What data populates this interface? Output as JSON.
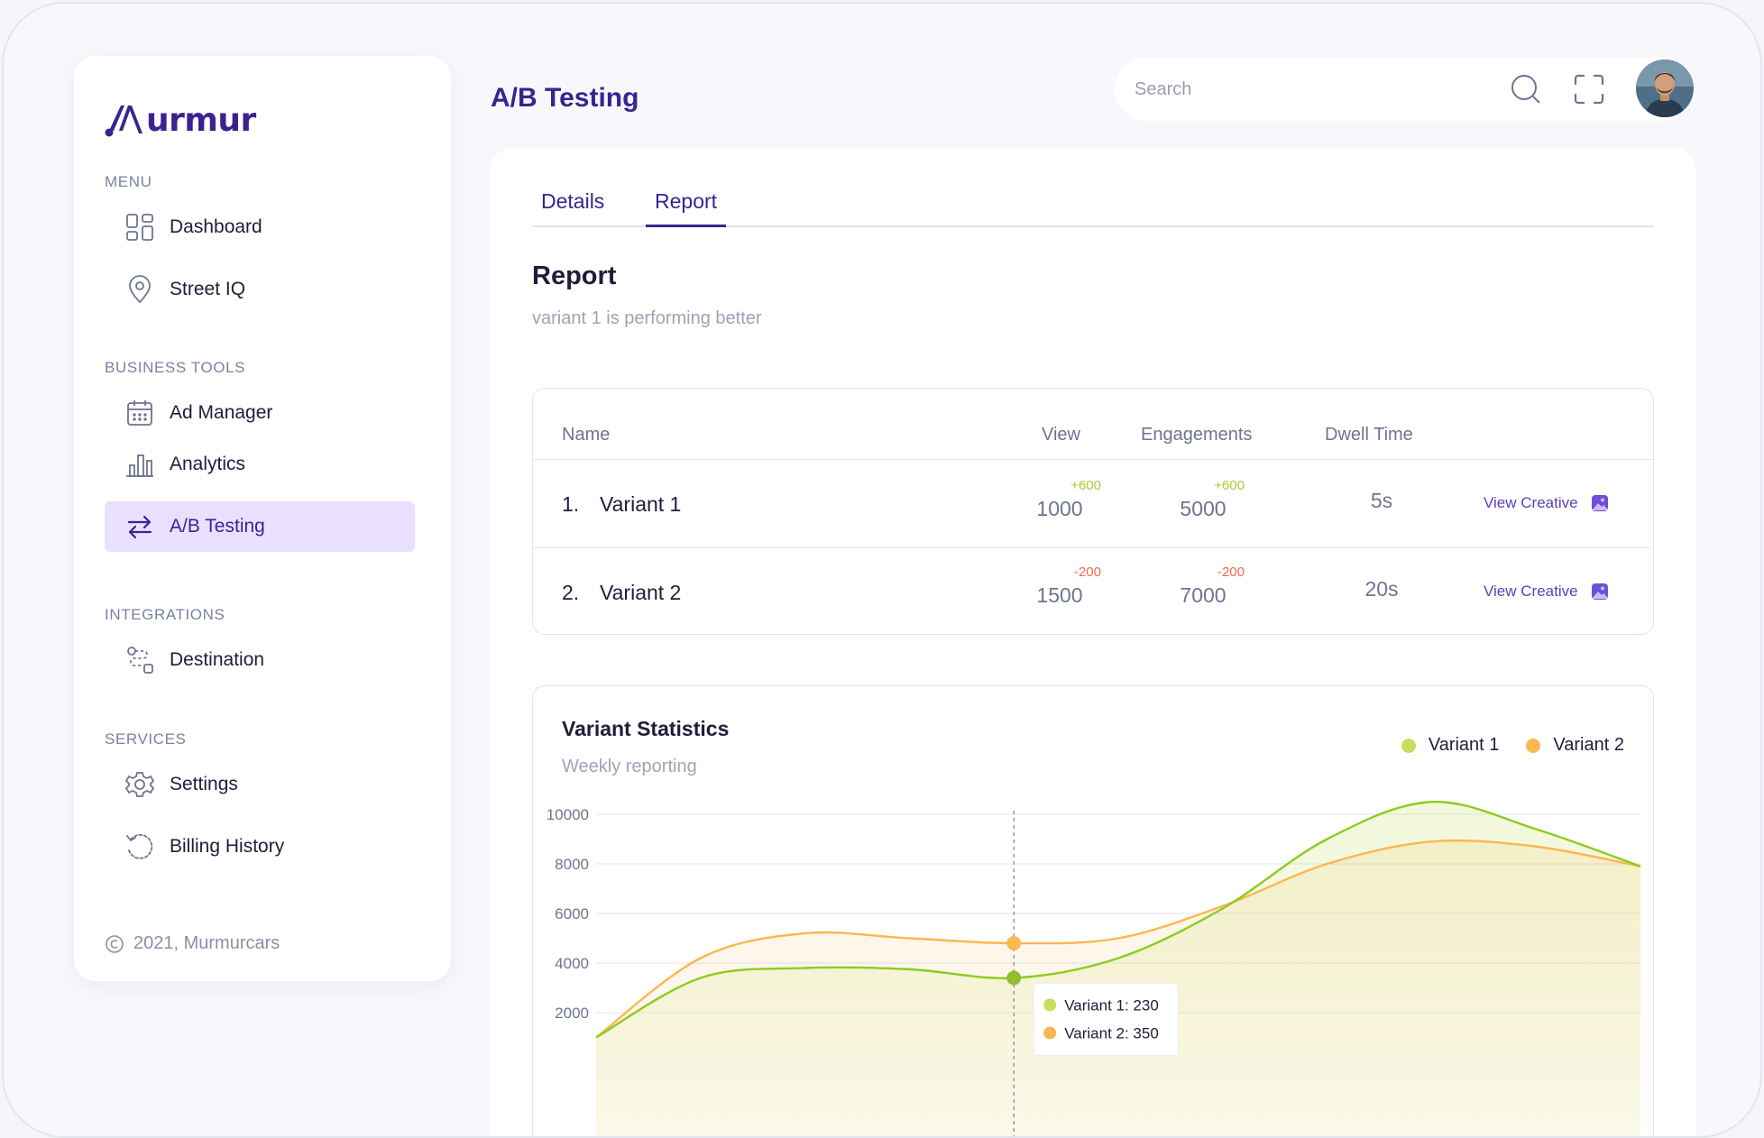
{
  "app": {
    "logo_text": "urmur",
    "brand_color": "#3a2391"
  },
  "sidebar": {
    "sections": [
      {
        "label": "MENU"
      },
      {
        "label": "BUSINESS TOOLS"
      },
      {
        "label": "INTEGRATIONS"
      },
      {
        "label": "SERVICES"
      }
    ],
    "items": [
      {
        "label": "Dashboard",
        "icon": "grid-icon"
      },
      {
        "label": "Street IQ",
        "icon": "location-pin-icon"
      },
      {
        "label": "Ad Manager",
        "icon": "calendar-icon"
      },
      {
        "label": "Analytics",
        "icon": "bar-chart-icon"
      },
      {
        "label": "A/B Testing",
        "icon": "swap-arrows-icon",
        "active": true
      },
      {
        "label": "Destination",
        "icon": "route-icon"
      },
      {
        "label": "Settings",
        "icon": "gear-icon"
      },
      {
        "label": "Billing History",
        "icon": "history-icon"
      }
    ],
    "copyright": "2021, Murmurcars"
  },
  "header": {
    "title": "A/B Testing",
    "search_placeholder": "Search"
  },
  "tabs": [
    {
      "label": "Details",
      "active": false
    },
    {
      "label": "Report",
      "active": true
    }
  ],
  "report": {
    "heading": "Report",
    "subtitle": "variant 1 is performing better"
  },
  "table": {
    "columns": [
      "Name",
      "View",
      "Engagements",
      "Dwell Time"
    ],
    "rows": [
      {
        "index": "1.",
        "name": "Variant 1",
        "view": "1000",
        "view_delta": "+600",
        "engagements": "5000",
        "engagements_delta": "+600",
        "dwell_time": "5s",
        "action": "View Creative"
      },
      {
        "index": "2.",
        "name": "Variant 2",
        "view": "1500",
        "view_delta": "-200",
        "engagements": "7000",
        "engagements_delta": "-200",
        "dwell_time": "20s",
        "action": "View Creative"
      }
    ]
  },
  "chart": {
    "title": "Variant Statistics",
    "subtitle": "Weekly reporting"
  },
  "chart_data": {
    "type": "area",
    "title": "Variant Statistics",
    "subtitle": "Weekly reporting",
    "y_ticks": [
      "10000",
      "8000",
      "6000",
      "4000",
      "2000"
    ],
    "ylim": [
      0,
      10000
    ],
    "grid": true,
    "legend_position": "top-right",
    "series": [
      {
        "name": "Variant 1",
        "color": "#8ccc1f",
        "values": [
          1000,
          3400,
          3800,
          3750,
          3400,
          4200,
          6200,
          9000,
          10500,
          9400,
          7900
        ]
      },
      {
        "name": "Variant 2",
        "color": "#fbb752",
        "values": [
          1000,
          4200,
          5200,
          5000,
          4800,
          5000,
          6300,
          8000,
          8900,
          8700,
          7900
        ]
      }
    ],
    "tooltip": {
      "lines": [
        "Variant 1: 230",
        "Variant 2: 350"
      ]
    }
  }
}
